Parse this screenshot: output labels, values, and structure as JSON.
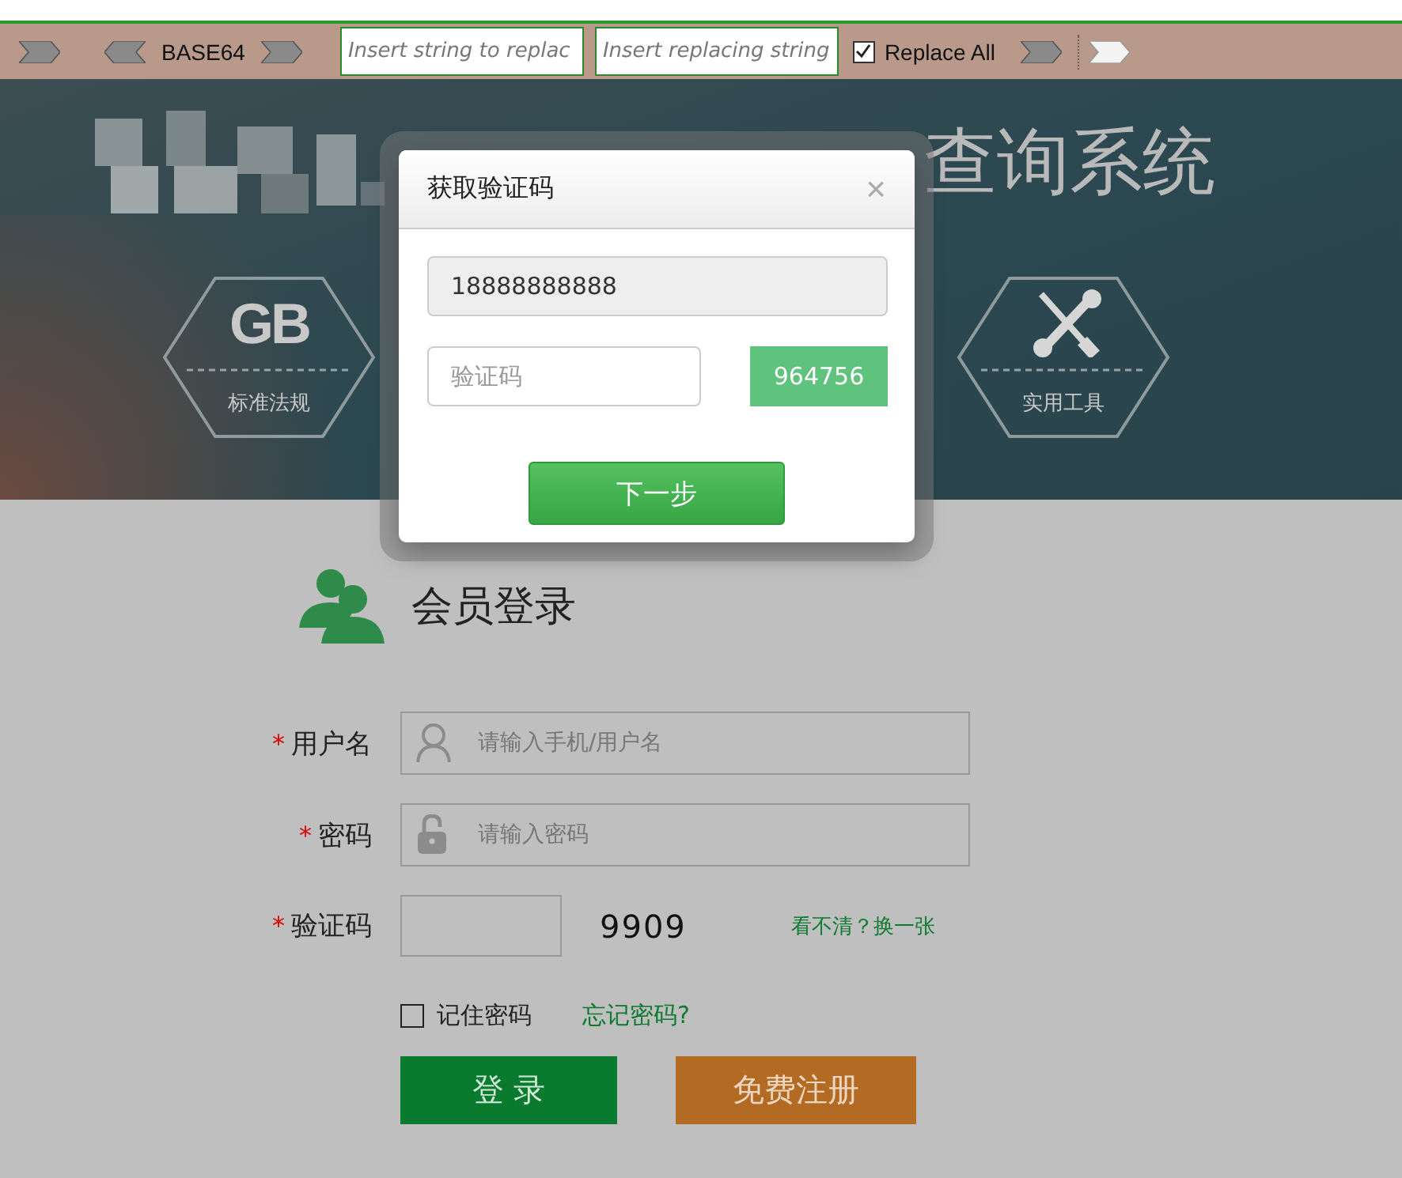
{
  "toolbar": {
    "items": [
      {
        "kind": "right-arrow",
        "light": false
      },
      {
        "kind": "left-arrow",
        "light": false
      },
      {
        "kind": "label",
        "text": "BASE64"
      },
      {
        "kind": "right-arrow",
        "light": false
      },
      {
        "kind": "input",
        "placeholder": "Insert string to replac"
      },
      {
        "kind": "input",
        "placeholder": "Insert replacing string"
      },
      {
        "kind": "checkbox",
        "label": "Replace All",
        "checked": true
      },
      {
        "kind": "right-arrow",
        "light": false
      },
      {
        "kind": "separator"
      },
      {
        "kind": "right-arrow",
        "light": true
      }
    ]
  },
  "banner": {
    "title": "查询系统",
    "tiles": [
      {
        "kind": "gb",
        "mark": "GB",
        "label": "标准法规"
      },
      {
        "kind": "tools",
        "label": "实用工具"
      }
    ]
  },
  "modal": {
    "title": "获取验证码",
    "close": "×",
    "phone": "18888888888",
    "code_placeholder": "验证码",
    "code": "964756",
    "next": "下一步"
  },
  "login": {
    "title": "会员登录",
    "fields": [
      {
        "kind": "user",
        "label": "用户名",
        "required": true,
        "placeholder": "请输入手机/用户名"
      },
      {
        "kind": "lock",
        "label": "密码",
        "required": true,
        "placeholder": "请输入密码"
      },
      {
        "kind": "captcha",
        "label": "验证码",
        "required": true,
        "captcha": "9909",
        "refresh": "看不清？换一张"
      }
    ],
    "required_mark": "*",
    "remember": {
      "label": "记住密码",
      "checked": false
    },
    "forgot": "忘记密码?",
    "login_button": "登 录",
    "register_button": "免费注册"
  }
}
